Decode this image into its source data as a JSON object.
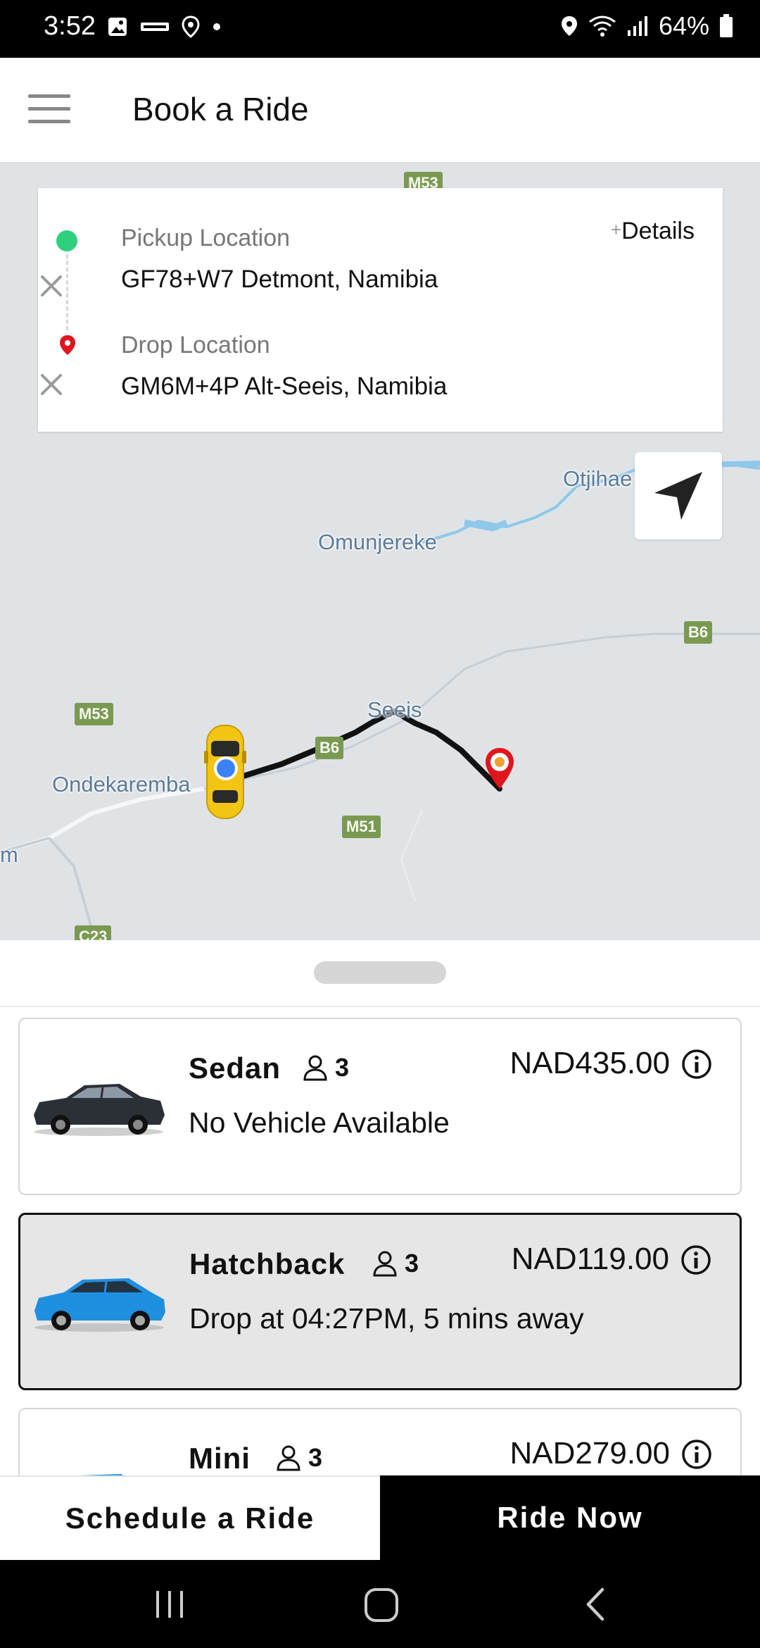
{
  "status_bar": {
    "time": "3:52",
    "battery": "64%",
    "icons": [
      "gallery-icon",
      "app-icon",
      "location-icon",
      "dot-icon",
      "location-icon",
      "wifi-icon",
      "signal-icon",
      "battery-icon"
    ]
  },
  "header": {
    "title": "Book a Ride",
    "menu_icon": "hamburger-menu-icon"
  },
  "location_card": {
    "pickup_label": "Pickup Location",
    "pickup_value": "GF78+W7 Detmont, Namibia",
    "drop_label": "Drop Location",
    "drop_value": "GM6M+4P Alt-Seeis, Namibia",
    "details_plus": "+",
    "details_label": "Details",
    "clear_icon": "close-icon"
  },
  "map": {
    "places": {
      "otjihae": "Otjihae",
      "omunjereke": "Omunjereke",
      "seeis": "Seeis",
      "ondekaremba": "Ondekaremba",
      "edge": "m"
    },
    "roads": {
      "m53_top": "M53",
      "m53_left": "M53",
      "b6_right": "B6",
      "b6_mid": "B6",
      "m51": "M51",
      "c23": "C23"
    },
    "colors": {
      "route": "#111111",
      "pickup": "#2fd07d",
      "drop": "#e0161e",
      "current_location": "#3b82f6",
      "water": "#8ec8ea"
    }
  },
  "rides": [
    {
      "name": "Sedan",
      "seats": "3",
      "price": "NAD435.00",
      "status": "No Vehicle Available",
      "selected": false,
      "car_color": "#2b2f36"
    },
    {
      "name": "Hatchback",
      "seats": "3",
      "price": "NAD119.00",
      "status": "Drop at 04:27PM, 5 mins away",
      "selected": true,
      "car_color": "#1f8fe0"
    },
    {
      "name": "Mini",
      "seats": "3",
      "price": "NAD279.00",
      "status": "",
      "selected": false,
      "car_color": "#1f8fe0"
    }
  ],
  "actions": {
    "schedule": "Schedule a Ride",
    "ride_now": "Ride Now"
  },
  "nav_bar": {
    "icons": [
      "recent-apps-icon",
      "home-icon",
      "back-icon"
    ]
  }
}
